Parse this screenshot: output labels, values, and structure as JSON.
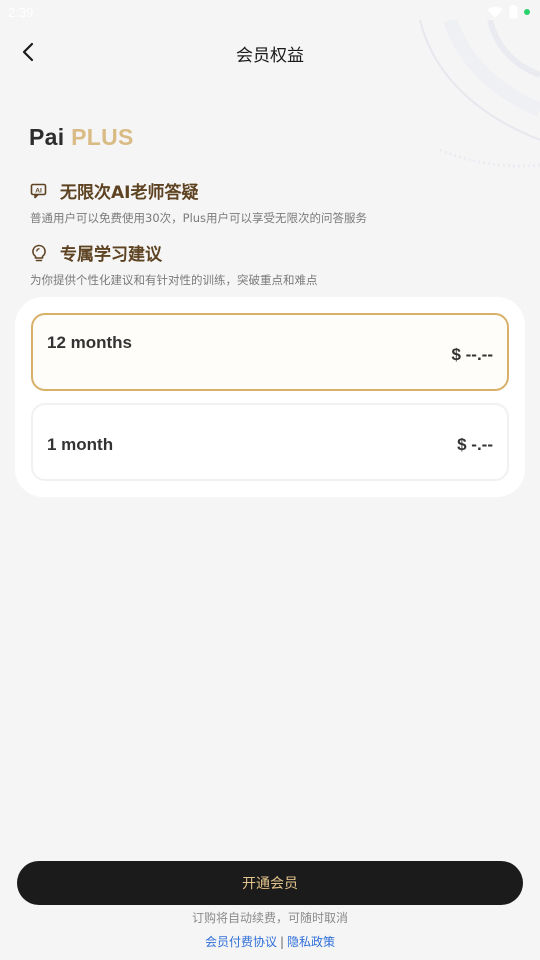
{
  "status_bar": {
    "time": "2:39"
  },
  "header": {
    "title": "会员权益"
  },
  "brand": {
    "name": "Pai",
    "tier": "PLUS"
  },
  "features": [
    {
      "icon": "ai-chat-icon",
      "title": "无限次AI老师答疑",
      "description": "普通用户可以免费使用30次，Plus用户可以享受无限次的问答服务"
    },
    {
      "icon": "lightbulb-icon",
      "title": "专属学习建议",
      "description": "为你提供个性化建议和有针对性的训练，突破重点和难点"
    }
  ],
  "plans": [
    {
      "name": "12 months",
      "price": "$ --.--",
      "selected": true
    },
    {
      "name": "1 month",
      "price": "$ -.--",
      "selected": false
    }
  ],
  "cta": {
    "label": "开通会员"
  },
  "footer": {
    "renew_note": "订购将自动续费，可随时取消",
    "agreement_link": "会员付费协议",
    "separator": "|",
    "privacy_link": "隐私政策"
  },
  "colors": {
    "accent_gold": "#d8b069",
    "feature_title": "#5e4322",
    "cta_background": "#1b1b1b",
    "link_blue": "#2f6fd9"
  }
}
